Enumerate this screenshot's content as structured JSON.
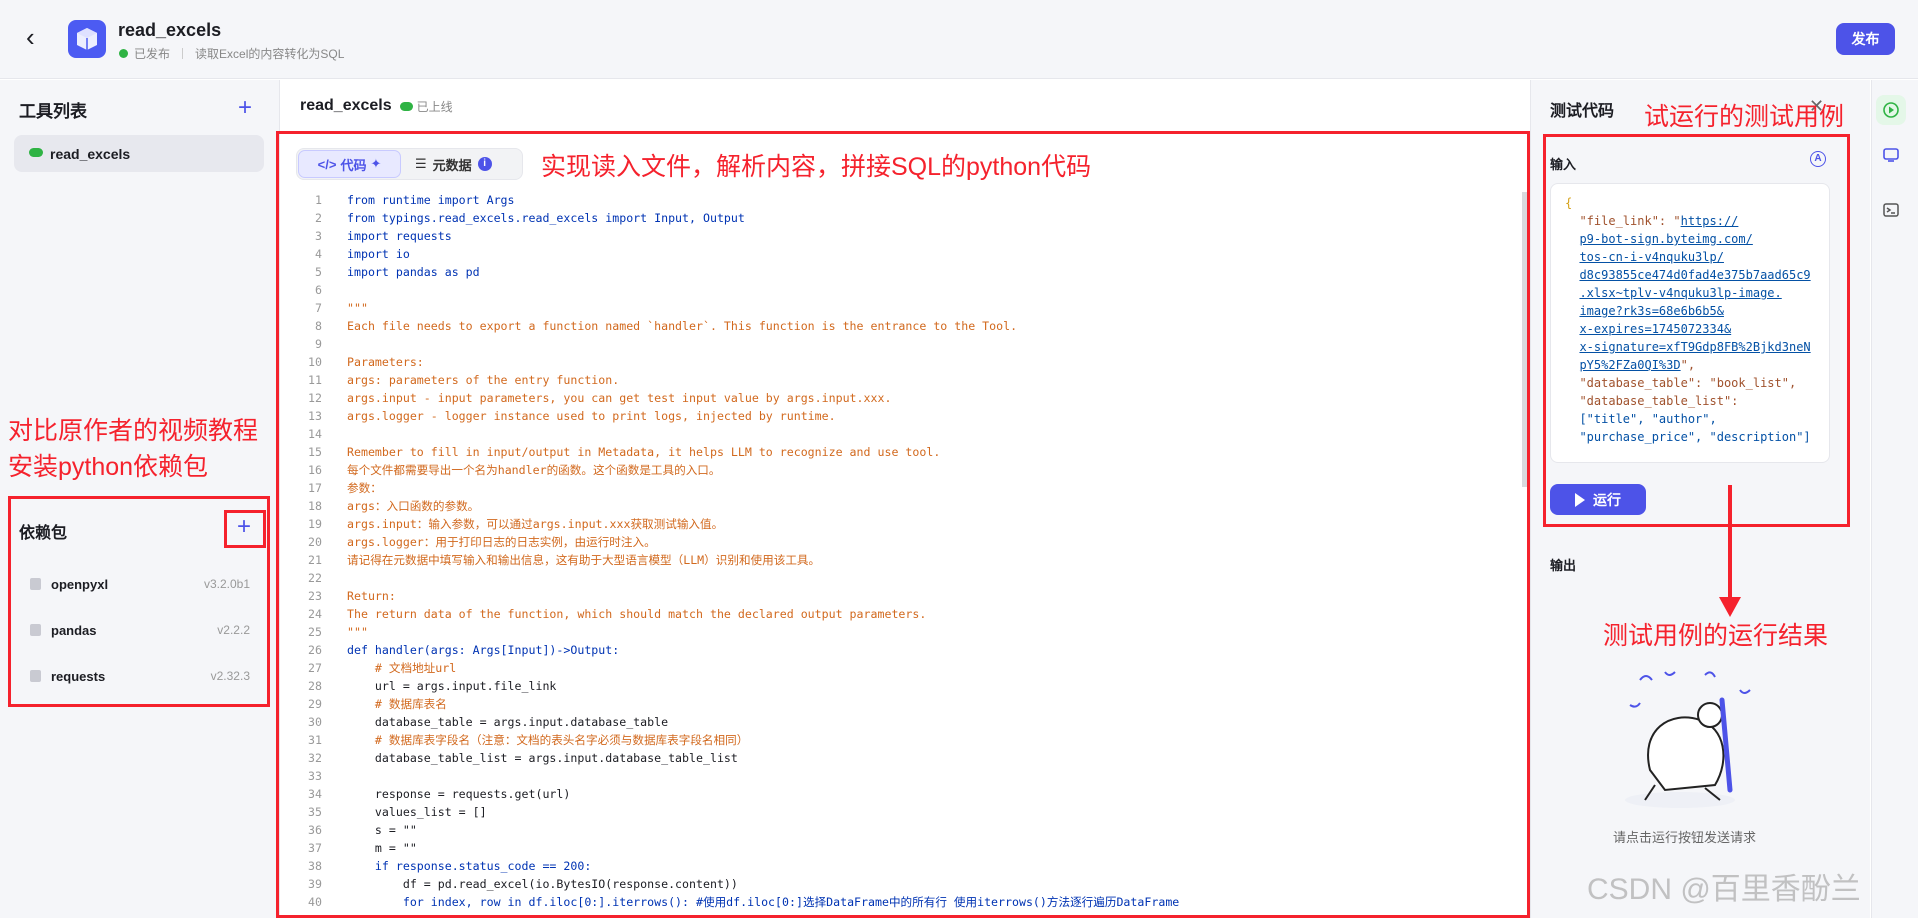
{
  "topbar": {
    "title": "read_excels",
    "status": "已发布",
    "description": "读取Excel的内容转化为SQL",
    "publish_label": "发布"
  },
  "left": {
    "tools_title": "工具列表",
    "tools": [
      {
        "label": "read_excels"
      }
    ],
    "deps_title": "依赖包",
    "deps": [
      {
        "name": "openpyxl",
        "version": "v3.2.0b1"
      },
      {
        "name": "pandas",
        "version": "v2.2.2"
      },
      {
        "name": "requests",
        "version": "v2.32.3"
      }
    ]
  },
  "center": {
    "title": "read_excels",
    "status": "已上线",
    "tab_code": "代码",
    "tab_meta": "元数据",
    "code_lines": [
      "from runtime import Args",
      "from typings.read_excels.read_excels import Input, Output",
      "import requests",
      "import io",
      "import pandas as pd",
      "",
      "\"\"\"",
      "Each file needs to export a function named `handler`. This function is the entrance to the Tool.",
      "",
      "Parameters:",
      "args: parameters of the entry function.",
      "args.input - input parameters, you can get test input value by args.input.xxx.",
      "args.logger - logger instance used to print logs, injected by runtime.",
      "",
      "Remember to fill in input/output in Metadata, it helps LLM to recognize and use tool.",
      "每个文件都需要导出一个名为handler的函数。这个函数是工具的入口。",
      "参数：",
      "args：入口函数的参数。",
      "args.input：输入参数，可以通过args.input.xxx获取测试输入值。",
      "args.logger：用于打印日志的日志实例，由运行时注入。",
      "请记得在元数据中填写输入和输出信息，这有助于大型语言模型（LLM）识别和使用该工具。",
      "",
      "Return:",
      "The return data of the function, which should match the declared output parameters.",
      "\"\"\"",
      "def handler(args: Args[Input])->Output:",
      "    # 文档地址url",
      "    url = args.input.file_link",
      "    # 数据库表名",
      "    database_table = args.input.database_table",
      "    # 数据库表字段名（注意：文档的表头名字必须与数据库表字段名相同）",
      "    database_table_list = args.input.database_table_list",
      "",
      "    response = requests.get(url)",
      "    values_list = []",
      "    s = \"\"",
      "    m = \"\"",
      "    if response.status_code == 200:",
      "        df = pd.read_excel(io.BytesIO(response.content))",
      "        for index, row in df.iloc[0:].iterrows(): #使用df.iloc[0:]选择DataFrame中的所有行 使用iterrows()方法逐行遍历DataFrame"
    ]
  },
  "right": {
    "title": "测试代码",
    "input_label": "输入",
    "json_lines": [
      {
        "t": "{",
        "c": "p"
      },
      {
        "t": "  \"file_link\": \"",
        "c": "k",
        "u": "https://"
      },
      {
        "t": "  ",
        "c": "k",
        "u": "p9-bot-sign.byteimg.com/"
      },
      {
        "t": "  ",
        "c": "k",
        "u": "tos-cn-i-v4nquku3lp/"
      },
      {
        "t": "  ",
        "c": "k",
        "u": "d8c93855ce474d0fad4e375b7aad65c9"
      },
      {
        "t": "  ",
        "c": "k",
        "u": ".xlsx~tplv-v4nquku3lp-image."
      },
      {
        "t": "  ",
        "c": "k",
        "u": "image?rk3s=68e6b6b5&"
      },
      {
        "t": "  ",
        "c": "k",
        "u": "x-expires=1745072334&"
      },
      {
        "t": "  ",
        "c": "k",
        "u": "x-signature=xfT9Gdp8FB%2Bjkd3neN"
      },
      {
        "t": "  ",
        "c": "k",
        "u": "pY5%2FZa0QI%3D",
        "tail": "\","
      },
      {
        "t": "  \"database_table\": \"book_list\",",
        "c": "k"
      },
      {
        "t": "  \"database_table_list\":",
        "c": "k"
      },
      {
        "t": "  [\"title\", \"author\",",
        "c": "v"
      },
      {
        "t": "  \"purchase_price\", \"description\"]",
        "c": "v"
      }
    ],
    "run_label": "运行",
    "output_label": "输出",
    "empty_hint": "请点击运行按钮发送请求"
  },
  "annotations": {
    "code_note": "实现读入文件，解析内容，拼接SQL的python代码",
    "test_note": "试运行的测试用例",
    "result_note": "测试用例的运行结果",
    "deps_note_1": "对比原作者的视频教程",
    "deps_note_2": "安装python依赖包"
  },
  "watermark": "CSDN @百里香酚兰",
  "colors": {
    "accent": "#4d53e8",
    "annotation": "#f5222d",
    "success": "#2fb344"
  }
}
